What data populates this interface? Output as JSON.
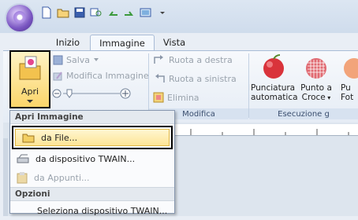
{
  "quick_access": [
    "new-document-icon",
    "open-folder-icon",
    "save-icon",
    "zoom-icon",
    "undo-icon",
    "redo-icon",
    "preview-icon",
    "dropdown-arrow-icon"
  ],
  "tabs": [
    {
      "label": "Inizio",
      "active": false
    },
    {
      "label": "Immagine",
      "active": true
    },
    {
      "label": "Vista",
      "active": false
    }
  ],
  "ribbon": {
    "apri_label": "Apri",
    "salva_label": "Salva",
    "modifica_immagine_label": "Modifica Immagine",
    "ruota_destra_label": "Ruota a destra",
    "ruota_sinistra_label": "Ruota a sinistra",
    "elimina_label": "Elimina",
    "modifica_group_label": "Modifica",
    "punciatura_label_1": "Punciatura",
    "punciatura_label_2": "automatica",
    "punto_croce_label_1": "Punto a",
    "punto_croce_label_2": "Croce",
    "foto_label_1": "Pu",
    "foto_label_2": "Fot",
    "esecuzione_group_label": "Esecuzione g",
    "apri_group_label": "Apri Immagine"
  },
  "menu": {
    "items": [
      {
        "label": "da File...",
        "highlighted": true,
        "disabled": false
      },
      {
        "label": "da dispositivo TWAIN...",
        "highlighted": false,
        "disabled": false
      },
      {
        "label": "da Appunti...",
        "highlighted": false,
        "disabled": true
      }
    ],
    "section_label": "Opzioni",
    "options_items": [
      {
        "label": "Seleziona dispositivo TWAIN..."
      }
    ]
  },
  "colors": {
    "accent": "#f5c542",
    "highlight_border": "#000000",
    "ribbon_bg": "#eef3f9"
  }
}
